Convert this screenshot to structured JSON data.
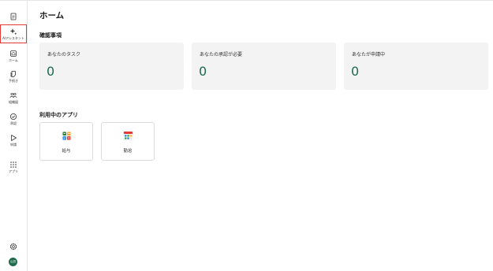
{
  "sidebar": {
    "items": [
      {
        "label": "",
        "icon": "document-icon"
      },
      {
        "label": "AIアシスタント",
        "icon": "ai-sparkle-icon"
      },
      {
        "label": "ホーム",
        "icon": "home-icon"
      },
      {
        "label": "手続き",
        "icon": "procedure-icon"
      },
      {
        "label": "組織図",
        "icon": "org-chart-icon"
      },
      {
        "label": "承認",
        "icon": "approve-icon"
      },
      {
        "label": "申請",
        "icon": "send-icon"
      },
      {
        "label": "アプリ",
        "icon": "apps-grid-icon"
      }
    ],
    "settings_icon": "gear-icon",
    "avatar_text": "山田"
  },
  "page": {
    "title": "ホーム"
  },
  "confirm_section": {
    "title": "確認事項",
    "cards": [
      {
        "label": "あなたのタスク",
        "count": "0"
      },
      {
        "label": "あなたの承認が必要",
        "count": "0"
      },
      {
        "label": "あなたが申請中",
        "count": "0"
      }
    ]
  },
  "apps_section": {
    "title": "利用中のアプリ",
    "apps": [
      {
        "label": "給与",
        "icon": "payroll-app-icon"
      },
      {
        "label": "勤怠",
        "icon": "attendance-calendar-icon"
      }
    ]
  },
  "colors": {
    "accent_green": "#1e6b4d",
    "active_border": "#e53935",
    "card_bg": "#f3f3f3"
  }
}
